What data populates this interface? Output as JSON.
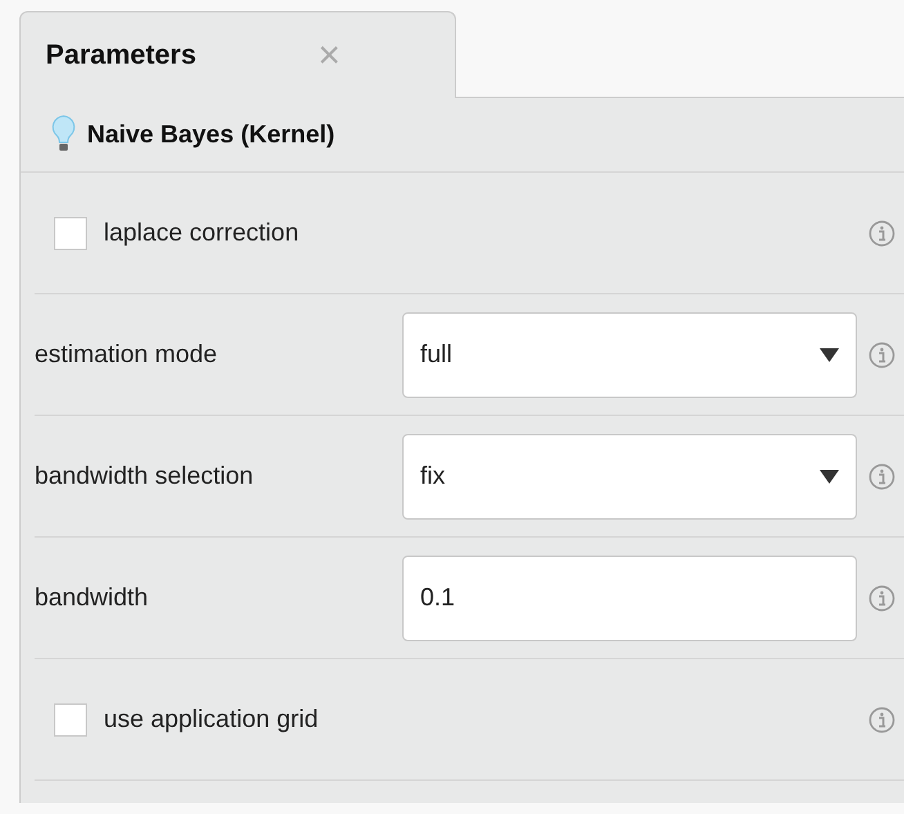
{
  "tab": {
    "label": "Parameters",
    "close": "×",
    "selected": true
  },
  "operator": {
    "name": "Naive Bayes (Kernel)"
  },
  "parameters": [
    {
      "kind": "checkbox",
      "label": "laplace correction",
      "checked": false
    },
    {
      "kind": "select",
      "label": "estimation mode",
      "value": "full"
    },
    {
      "kind": "select",
      "label": "bandwidth selection",
      "value": "fix"
    },
    {
      "kind": "text",
      "label": "bandwidth",
      "value": "0.1"
    },
    {
      "kind": "checkbox",
      "label": "use application grid",
      "checked": false
    }
  ]
}
